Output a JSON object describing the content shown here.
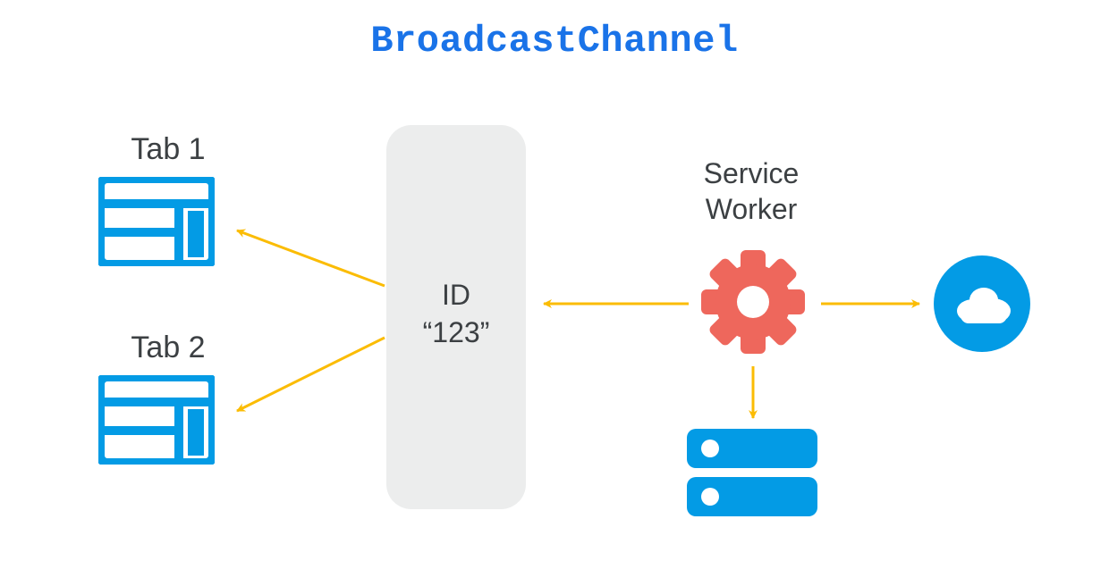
{
  "title": {
    "text": "BroadcastChannel",
    "color": "#1a73e8"
  },
  "channel": {
    "id_label": "ID",
    "id_value": "“123”"
  },
  "tabs": [
    {
      "label": "Tab 1"
    },
    {
      "label": "Tab 2"
    }
  ],
  "service_worker": {
    "label_line1": "Service",
    "label_line2": "Worker"
  },
  "colors": {
    "accent_blue": "#039be5",
    "title_blue": "#1a73e8",
    "arrow_orange": "#fbbc04",
    "gear_red": "#ee675c",
    "channel_bg": "#eceded",
    "text": "#3c4043"
  },
  "icons": {
    "tab": "browser-window-icon",
    "service_worker": "gear-icon",
    "cloud": "cloud-icon",
    "storage": "server-stack-icon"
  }
}
